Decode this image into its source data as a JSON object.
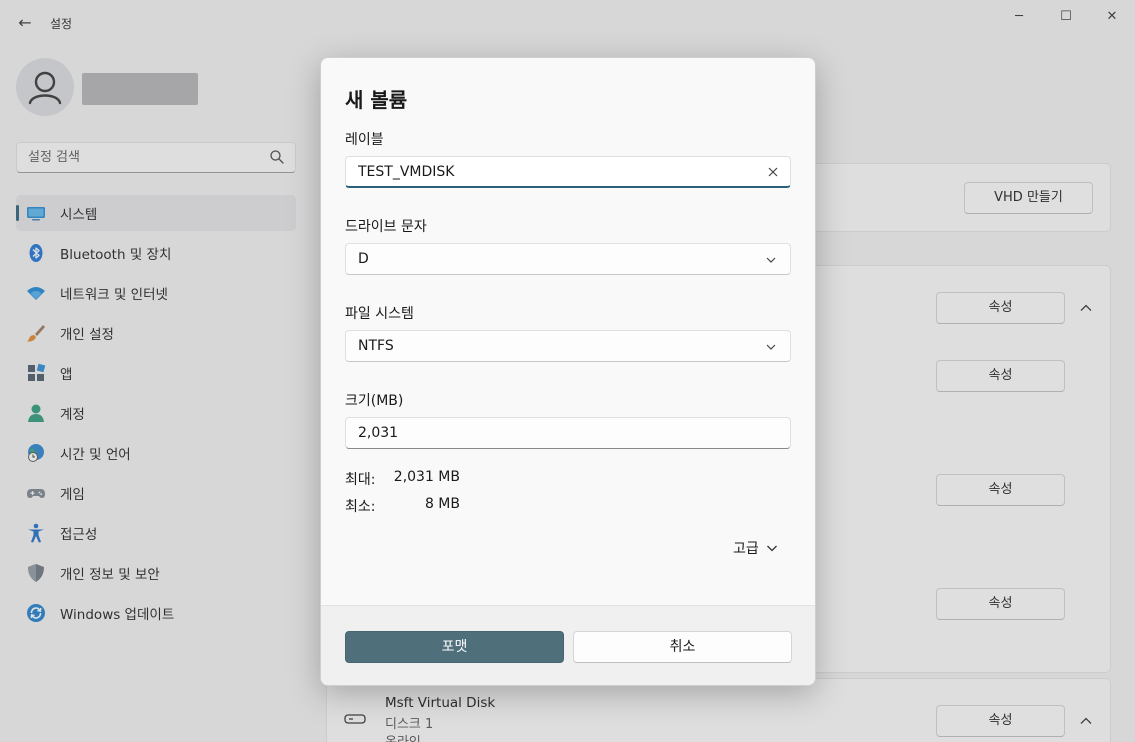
{
  "window": {
    "title": "설정",
    "back_glyph": "←",
    "min_glyph": "─",
    "max_glyph": "☐",
    "close_glyph": "✕"
  },
  "search": {
    "placeholder": "설정 검색"
  },
  "sidebar": {
    "items": [
      {
        "label": "시스템",
        "icon": "system-display-icon",
        "selected": true
      },
      {
        "label": "Bluetooth 및 장치",
        "icon": "bluetooth-icon"
      },
      {
        "label": "네트워크 및 인터넷",
        "icon": "wifi-icon"
      },
      {
        "label": "개인 설정",
        "icon": "paintbrush-icon"
      },
      {
        "label": "앱",
        "icon": "apps-icon"
      },
      {
        "label": "계정",
        "icon": "account-icon"
      },
      {
        "label": "시간 및 언어",
        "icon": "globe-clock-icon"
      },
      {
        "label": "게임",
        "icon": "gamepad-icon"
      },
      {
        "label": "접근성",
        "icon": "accessibility-icon"
      },
      {
        "label": "개인 정보 및 보안",
        "icon": "shield-icon"
      },
      {
        "label": "Windows 업데이트",
        "icon": "update-icon"
      }
    ]
  },
  "background": {
    "vhd_button": "VHD 만들기",
    "properties_label": "속성",
    "disk": {
      "name": "Msft Virtual Disk",
      "number": "디스크 1",
      "status": "온라인"
    }
  },
  "dialog": {
    "title": "새 볼륨",
    "label_field": {
      "label": "레이블",
      "value": "TEST_VMDISK"
    },
    "drive_letter": {
      "label": "드라이브 문자",
      "value": "D"
    },
    "file_system": {
      "label": "파일 시스템",
      "value": "NTFS"
    },
    "size": {
      "label": "크기(MB)",
      "value": "2,031"
    },
    "max": {
      "label": "최대:",
      "value": "2,031 MB"
    },
    "min": {
      "label": "최소:",
      "value": "8 MB"
    },
    "advanced_label": "고급",
    "format_button": "포맷",
    "cancel_button": "취소"
  },
  "colors": {
    "accent": "#2a6178",
    "primary_button": "#4f6f7b"
  }
}
